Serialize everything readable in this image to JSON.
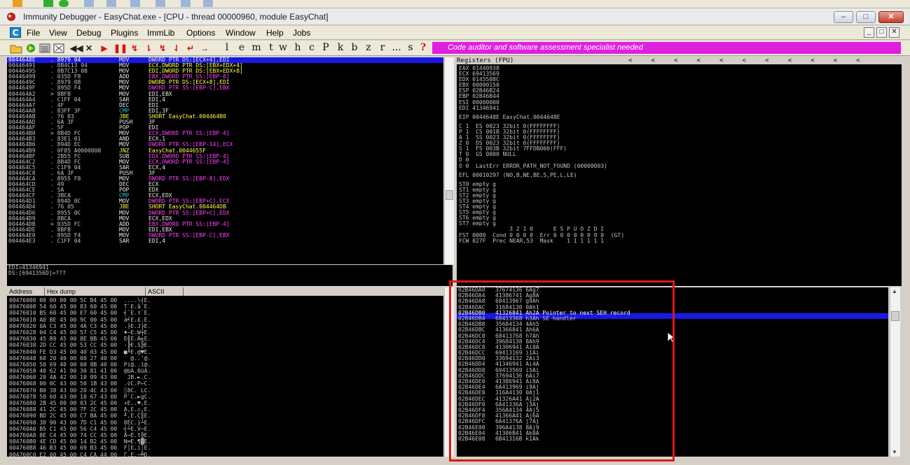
{
  "window": {
    "title": "Immunity Debugger - EasyChat.exe - [CPU - thread 00000960, module EasyChat]",
    "min": "–",
    "max": "□",
    "close": "✕"
  },
  "menu": {
    "items": [
      "File",
      "View",
      "Debug",
      "Plugins",
      "ImmLib",
      "Options",
      "Window",
      "Help",
      "Jobs"
    ],
    "mdi_min": "_",
    "mdi_max": "□",
    "mdi_close": "✕"
  },
  "toolbar": {
    "letters": [
      "l",
      "e",
      "m",
      "t",
      "w",
      "h",
      "c",
      "P",
      "k",
      "b",
      "z",
      "r",
      "...",
      "s",
      "?"
    ],
    "banner": "Code auditor and software assessment specialist needed",
    "icons": [
      "open-icon",
      "run-icon",
      "list-icon",
      "bitmap-icon",
      "rewind-icon",
      "close-icon",
      "play-icon",
      "pause-icon",
      "step-into-icon",
      "step-over-icon",
      "trace-into-icon",
      "trace-over-icon",
      "execute-till-return-icon",
      "goto-icon"
    ]
  },
  "cpu": {
    "selected_index": 0,
    "rows": [
      {
        "addr": "0044648E",
        "hex": ". 8979 04",
        "op": "MOV",
        "ops": "DWORD PTR DS:[ECX+4],EDI"
      },
      {
        "addr": "00446491",
        "hex": ". 8B4C13 04",
        "op": "MOV",
        "ops": "ECX,DWORD PTR DS:[EBX+EDX+4]"
      },
      {
        "addr": "00446495",
        "hex": ". 8B7C13 08",
        "op": "MOV",
        "ops": "EDI,DWORD PTR DS:[EBX+EDX+8]"
      },
      {
        "addr": "00446499",
        "hex": ". 035D F8",
        "op": "ADD",
        "ops": "EBX,DWORD PTR SS:[EBP-8]"
      },
      {
        "addr": "0044649C",
        "hex": ". 8979 08",
        "op": "MOV",
        "ops": "DWORD PTR DS:[ECX+8],EDI"
      },
      {
        "addr": "0044649F",
        "hex": ". 895D F4",
        "op": "MOV",
        "ops": "DWORD PTR SS:[EBP-C],EBX"
      },
      {
        "addr": "004464A2",
        "hex": "> 8BFB",
        "op": "MOV",
        "ops": "EDI,EBX"
      },
      {
        "addr": "004464A4",
        "hex": ". C1FF 04",
        "op": "SAR",
        "ops": "EDI,4"
      },
      {
        "addr": "004464A7",
        "hex": ". 4F",
        "op": "DEC",
        "ops": "EDI"
      },
      {
        "addr": "004464A8",
        "hex": ". 83FF 3F",
        "op": "CMP",
        "ops": "EDI,3F"
      },
      {
        "addr": "004464AB",
        "hex": ". 76 03",
        "op": "JBE",
        "ops": "SHORT EasyChat.004464B0"
      },
      {
        "addr": "004464AD",
        "hex": ". 6A 3F",
        "op": "PUSH",
        "ops": "3F"
      },
      {
        "addr": "004464AF",
        "hex": ". 5F",
        "op": "POP",
        "ops": "EDI"
      },
      {
        "addr": "004464B0",
        "hex": "> 8B4D FC",
        "op": "MOV",
        "ops": "ECX,DWORD PTR SS:[EBP-4]"
      },
      {
        "addr": "004464B3",
        "hex": ". 83E1 01",
        "op": "AND",
        "ops": "ECX,1"
      },
      {
        "addr": "004464B6",
        "hex": ". 894D EC",
        "op": "MOV",
        "ops": "DWORD PTR SS:[EBP-14],ECX"
      },
      {
        "addr": "004464B9",
        "hex": ". 0F85 A0000000",
        "op": "JNZ",
        "ops": "EasyChat.0044655F"
      },
      {
        "addr": "004464BF",
        "hex": ". 2B55 FC",
        "op": "SUB",
        "ops": "EDX,DWORD PTR SS:[EBP-4]"
      },
      {
        "addr": "004464C2",
        "hex": ". 8B4D FC",
        "op": "MOV",
        "ops": "ECX,DWORD PTR SS:[EBP-4]"
      },
      {
        "addr": "004464C5",
        "hex": ". C1F9 04",
        "op": "SAR",
        "ops": "ECX,4"
      },
      {
        "addr": "004464C8",
        "hex": ". 6A 3F",
        "op": "PUSH",
        "ops": "3F"
      },
      {
        "addr": "004464CA",
        "hex": ". 8955 F8",
        "op": "MOV",
        "ops": "DWORD PTR SS:[EBP-8],EDX"
      },
      {
        "addr": "004464CD",
        "hex": ". 49",
        "op": "DEC",
        "ops": "ECX"
      },
      {
        "addr": "004464CE",
        "hex": ". 5A",
        "op": "POP",
        "ops": "EDX"
      },
      {
        "addr": "004464CF",
        "hex": ". 3BCA",
        "op": "CMP",
        "ops": "ECX,EDX"
      },
      {
        "addr": "004464D1",
        "hex": ". 894D 0C",
        "op": "MOV",
        "ops": "DWORD PTR SS:[EBP+C],ECX"
      },
      {
        "addr": "004464D4",
        "hex": ". 76 05",
        "op": "JBE",
        "ops": "SHORT EasyChat.004464DB"
      },
      {
        "addr": "004464D6",
        "hex": ". 8955 0C",
        "op": "MOV",
        "ops": "DWORD PTR SS:[EBP+C],EDX"
      },
      {
        "addr": "004464D9",
        "hex": ". 8BCA",
        "op": "MOV",
        "ops": "ECX,EDX"
      },
      {
        "addr": "004464DB",
        "hex": "> 035D FC",
        "op": "ADD",
        "ops": "EBX,DWORD PTR SS:[EBP-4]"
      },
      {
        "addr": "004464DE",
        "hex": ". 8BFB",
        "op": "MOV",
        "ops": "EDI,EBX"
      },
      {
        "addr": "004464E0",
        "hex": ". 895D F4",
        "op": "MOV",
        "ops": "DWORD PTR SS:[EBP-C],EBX"
      },
      {
        "addr": "004464E3",
        "hex": ". C1FF 04",
        "op": "SAR",
        "ops": "EDI,4"
      }
    ]
  },
  "info": {
    "line1": "EDI=41346941",
    "line2": "DS:[6941356D]=???"
  },
  "registers": {
    "header": "Registers (FPU)",
    "header_arrows": "<     <     <     <     <     <     <     <     <     <     <",
    "lines": [
      "EAX 01440938",
      "ECX 69413569",
      "EDX 0145508C",
      "EBX 00000150",
      "ESP 02B46B24",
      "EBP 02B46B44",
      "ESI 00000000",
      "EDI 41346941",
      "",
      "EIP 0044648E EasyChat.0044648E",
      "",
      "C 1  ES 0023 32bit 0(FFFFFFFF)",
      "P 1  CS 001B 32bit 0(FFFFFFFF)",
      "A 1  SS 0023 32bit 0(FFFFFFFF)",
      "Z 0  DS 0023 32bit 0(FFFFFFFF)",
      "S 1  FS 003B 32bit 7FFDB000(FFF)",
      "T 0  GS 0000 NULL",
      "D 0",
      "O 0  LastErr ERROR_PATH_NOT_FOUND (00000003)",
      "",
      "EFL 00010297 (NO,B,NE,BE,S,PE,L,LE)",
      "",
      "ST0 empty g",
      "ST1 empty g",
      "ST2 empty g",
      "ST3 empty g",
      "ST4 empty g",
      "ST5 empty g",
      "ST6 empty g",
      "ST7 empty g",
      "               3 2 1 0      E S P U O Z D I",
      "FST 0000  Cond 0 0 0 0  Err 0 0 0 0 0 0 0 0  (GT)",
      "FCW 027F  Prec NEAR,53  Mask    1 1 1 1 1 1"
    ]
  },
  "dump": {
    "headers": [
      "Address",
      "Hex dump",
      "ASCII"
    ],
    "rows": [
      "00476000 00 00 00 00 5C B4 45 00  ....\\┤E.",
      "00476008 54 60 45 00 83 60 45 00  T`E.â`E.",
      "00476010 B5 60 45 00 E7 60 45 00  ╡`E.τ`E.",
      "00476018 A0 BE 45 00 9C 00 45 00  á╛E.£.E.",
      "00476020 0A C3 45 00 4A C3 45 00  .├E.J├E.",
      "00476028 04 C4 45 00 57 C5 45 00  ♦─E.W┼E.",
      "00476030 45 B9 45 00 8E BB 45 00  E╣E.Ä╗E.",
      "00476038 2D CC 45 00 53 CC 45 00  -╠E.S╠E.",
      "00476040 FE D3 45 00 40 03 45 00  ■╙E.@♥E.",
      "00476048 60 20 40 00 00 27 40 00  ` @..'@.",
      "00476050 50 69 40 00 00 8B 40 00  Pi@..ï@.",
      "00476058 40 62 41 00 30 81 41 00  @bA.0üA.",
      "00476060 20 4A 42 00 10 09 43 00   JB.►.C.",
      "00476068 00 0C 43 00 50 1B 43 00  .♀C.P←C.",
      "00476070 B0 38 43 00 20 4C 43 00  ░8C. LC.",
      "00476078 50 60 43 00 10 67 43 00  P`C.►gC.",
      "00476080 2B 45 00 00 03 2C 45 00  +E..♥,E.",
      "00476088 41 2C 45 00 7F 2C 45 00  A,E.⌂,E.",
      "00476090 BD 2C 45 00 C7 BA 45 00  ╜,E.Ç║E.",
      "00476098 38 90 43 00 7D C1 45 00  8ÉC.}┴E.",
      "004760A0 B5 C1 45 00 56 C4 45 00  ╡┴E.V─E.",
      "004760A8 8E C4 45 00 74 CC 45 00  Ä─E.t╠E.",
      "004760B0 4E CD 45 00 14 B2 45 00  N═E.¶▓E.",
      "004760B8 46 B3 45 00 69 B3 45 00  F│E.i│E.",
      "004760C0 E2 00 45 00 C4 CA 44 00  Γ.E.─╩D."
    ]
  },
  "stack": {
    "selected_index": 5,
    "rows": [
      "02B46DA0   37674136 6Ag7",
      "02B46DA4   41386741 Ag8A",
      "02B46DA8   68413967 g9Ah",
      "02B46DAC   31684130 0Ah1",
      "02B46DB0   41326841 Ah2A Pointer to next SEH record",
      "02B46DB4   68413368 h3Ah SE handler",
      "02B46DB8   35684134 4Ah5",
      "02B46DBC   41366841 Ah6A",
      "02B46DC0   68413768 h7Ah",
      "02B46DC4   39684138 8Ah9",
      "02B46DC8   41306941 Ai0A",
      "02B46DCC   69413169 i1Ai",
      "02B46DD0   33694132 2Ai3",
      "02B46DD4   41346941 Ai4A",
      "02B46DD8   69413569 i5Ai",
      "02B46DDC   37694136 6Ai7",
      "02B46DE0   41386941 Ai8A",
      "02B46DE4   6A413969 i9Aj",
      "02B46DE8   316A4130 0Aj1",
      "02B46DEC   41326A41 Aj2A",
      "02B46DF0   6A41336A j3Aj",
      "02B46DF4   356A4134 4Aj5",
      "02B46DF8   41366A41 Aj6A",
      "02B46DFC   6A41376A j7Aj",
      "02B46E00   396A4138 8Aj9",
      "02B46E04   41306B41 Ak0A",
      "02B46E08   6B41316B k1Ak"
    ]
  }
}
